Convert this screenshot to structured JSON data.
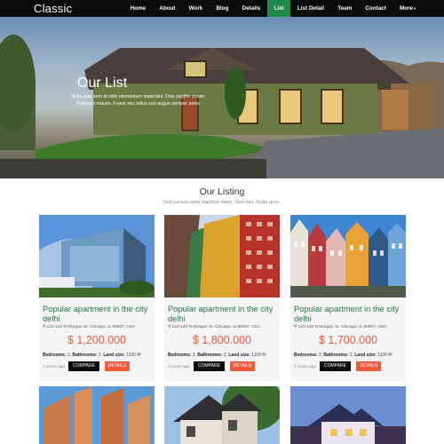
{
  "nav": {
    "logo": "Classic",
    "items": [
      "Home",
      "About",
      "Work",
      "Blog",
      "Details",
      "List",
      "List Detail",
      "Team",
      "Contact",
      "More"
    ],
    "more_caret": "▾",
    "active_index": 5
  },
  "hero": {
    "title": "Our List",
    "text": "Nulla quis sem at nibh elementum imperdiet. Duis sagittis ipsum. Praesent mauris. Fusce nec tellus sed augue semper porta."
  },
  "listing": {
    "title": "Our Listing",
    "subtitle": "Sed cursus ante dapibus diam. Sed nisi. Nulla quis.."
  },
  "cards": [
    {
      "title": "Popular apartment in the city delhi",
      "address": "122-140 N Morgan St, Chicago, IL 60607, USA",
      "price": "$ 1,200.000",
      "bedrooms_label": "Bedrooms:",
      "bedrooms": "3",
      "bathrooms_label": "Bathrooms:",
      "bathrooms": "2",
      "land_label": "Land size:",
      "land": "1100 ft²",
      "ago": "2 years ago",
      "compare": "COMPARE",
      "details": "DETAILS"
    },
    {
      "title": "Popular apartment in the city delhi",
      "address": "122-140 N Morgan St, Chicago, IL 60607, USA",
      "price": "$ 1,800.000",
      "bedrooms_label": "Bedrooms:",
      "bedrooms": "3",
      "bathrooms_label": "Bathrooms:",
      "bathrooms": "2",
      "land_label": "Land size:",
      "land": "1100 ft²",
      "ago": "2 years ago",
      "compare": "COMPARE",
      "details": "DETAILS"
    },
    {
      "title": "Popular apartment in the city delhi",
      "address": "122-140 N Morgan St, Chicago, IL 60607, USA",
      "price": "$ 1,700.000",
      "bedrooms_label": "Bedrooms:",
      "bedrooms": "3",
      "bathrooms_label": "Bathrooms:",
      "bathrooms": "2",
      "land_label": "Land size:",
      "land": "1100 ft²",
      "ago": "2 years ago",
      "compare": "COMPARE",
      "details": "DETAILS"
    }
  ],
  "icons": {
    "address": "map-pin-icon"
  }
}
